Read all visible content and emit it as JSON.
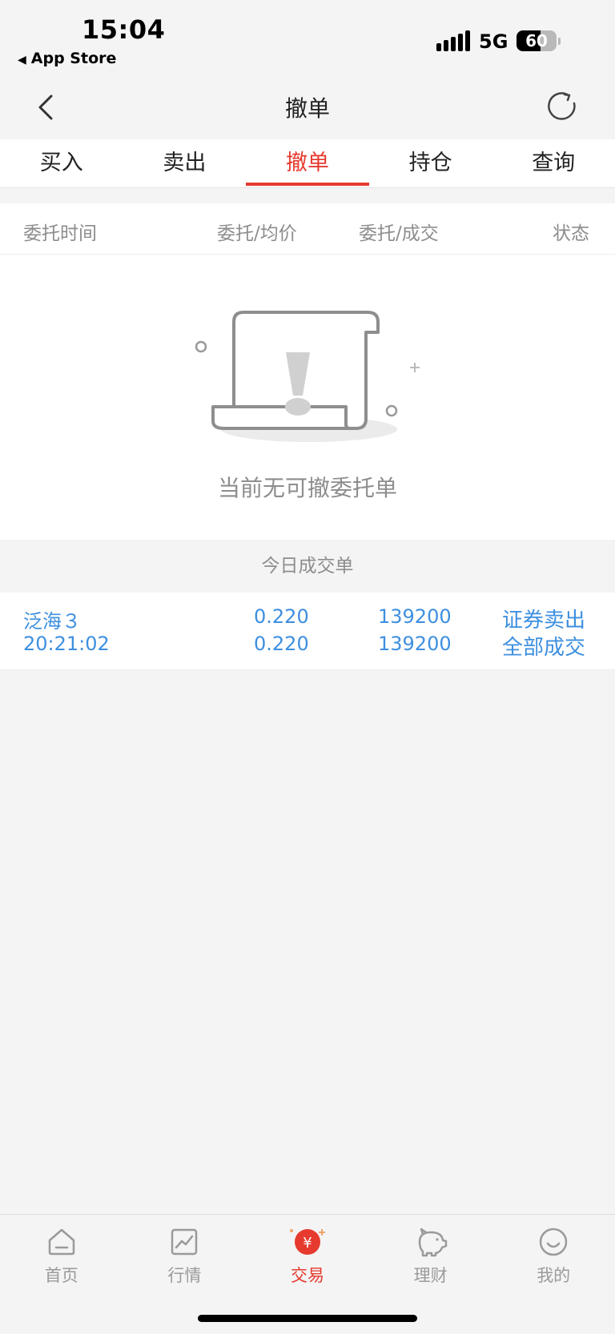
{
  "status_bar": {
    "time": "15:04",
    "back_app": "App Store",
    "network": "5G",
    "battery": "60",
    "battery_level": 0.6
  },
  "nav": {
    "title": "撤单"
  },
  "tabs": [
    "买入",
    "卖出",
    "撤单",
    "持仓",
    "查询"
  ],
  "active_tab": "撤单",
  "table_header": {
    "time": "委托时间",
    "price": "委托/均价",
    "amount": "委托/成交",
    "status": "状态"
  },
  "empty": {
    "text": "当前无可撤委托单"
  },
  "today_section": {
    "label": "今日成交单"
  },
  "deals": [
    {
      "name": "泛海３",
      "time": "20:21:02",
      "entrust_price": "0.220",
      "avg_price": "0.220",
      "entrust_qty": "139200",
      "deal_qty": "139200",
      "type": "证券卖出",
      "status": "全部成交"
    }
  ],
  "tabbar": [
    {
      "label": "首页",
      "icon": "home-icon"
    },
    {
      "label": "行情",
      "icon": "market-chart-icon"
    },
    {
      "label": "交易",
      "icon": "trade-yen-icon"
    },
    {
      "label": "理财",
      "icon": "piggy-bank-icon"
    },
    {
      "label": "我的",
      "icon": "smile-face-icon"
    }
  ],
  "colors": {
    "accent": "#e63a2e",
    "deal_text": "#3d8fe0",
    "muted_text": "#8d8d8d",
    "background": "#f4f4f4"
  }
}
